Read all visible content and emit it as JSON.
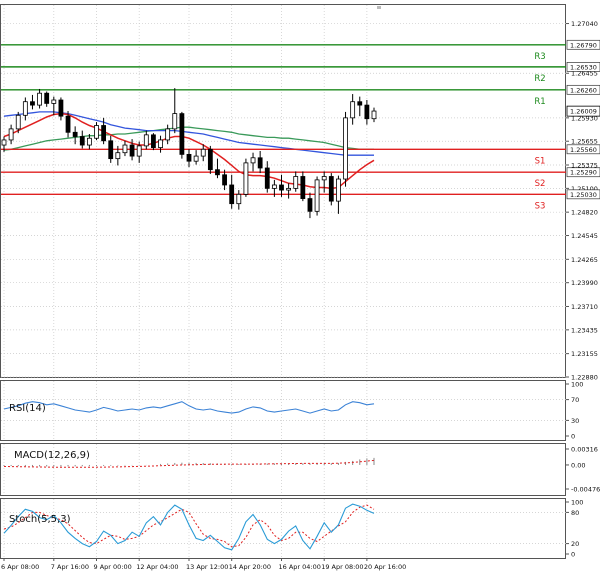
{
  "chart_data": {
    "type": "candlestick",
    "main": {
      "y_ticks": [
        "1.27040",
        "1.26455",
        "1.25930",
        "1.25655",
        "1.25375",
        "1.25100",
        "1.24820",
        "1.24545",
        "1.24265",
        "1.23990",
        "1.23710",
        "1.23435",
        "1.23155",
        "1.22880"
      ],
      "y_range": [
        1.2288,
        1.2727
      ],
      "levels": [
        {
          "name": "R3",
          "value": 1.2679,
          "label": "1.26790",
          "color": "#1e8a1e"
        },
        {
          "name": "R2",
          "value": 1.2653,
          "label": "1.26530",
          "color": "#1e8a1e"
        },
        {
          "name": "R1",
          "value": 1.2626,
          "label": "1.26260",
          "color": "#1e8a1e"
        },
        {
          "name": "S1",
          "value": 1.2556,
          "label": "1.25560",
          "color": "#e02020"
        },
        {
          "name": "S2",
          "value": 1.2529,
          "label": "1.25290",
          "color": "#e02020"
        },
        {
          "name": "S3",
          "value": 1.2503,
          "label": "1.25030",
          "color": "#e02020"
        }
      ],
      "current_price": {
        "value": 1.26009,
        "label": "1.26009"
      },
      "candles": [
        [
          1.2561,
          1.2571,
          1.2553,
          1.2567
        ],
        [
          1.2567,
          1.2585,
          1.2562,
          1.258
        ],
        [
          1.258,
          1.26,
          1.2575,
          1.2596
        ],
        [
          1.2596,
          1.2617,
          1.259,
          1.2612
        ],
        [
          1.2612,
          1.262,
          1.2603,
          1.2608
        ],
        [
          1.2608,
          1.2627,
          1.2604,
          1.2622
        ],
        [
          1.2622,
          1.2624,
          1.2606,
          1.261
        ],
        [
          1.261,
          1.2618,
          1.2596,
          1.2614
        ],
        [
          1.2614,
          1.2617,
          1.259,
          1.2595
        ],
        [
          1.2595,
          1.2601,
          1.257,
          1.2576
        ],
        [
          1.2576,
          1.2583,
          1.2562,
          1.2571
        ],
        [
          1.2571,
          1.2578,
          1.2557,
          1.2561
        ],
        [
          1.2561,
          1.2574,
          1.2556,
          1.2569
        ],
        [
          1.2569,
          1.2588,
          1.2567,
          1.2584
        ],
        [
          1.2584,
          1.2593,
          1.2562,
          1.2566
        ],
        [
          1.2566,
          1.2572,
          1.254,
          1.2545
        ],
        [
          1.2545,
          1.256,
          1.2537,
          1.2552
        ],
        [
          1.2552,
          1.2566,
          1.2548,
          1.2561
        ],
        [
          1.2561,
          1.2568,
          1.2543,
          1.2548
        ],
        [
          1.2548,
          1.2565,
          1.254,
          1.256
        ],
        [
          1.256,
          1.2578,
          1.2556,
          1.2573
        ],
        [
          1.2573,
          1.2575,
          1.2555,
          1.2558
        ],
        [
          1.2558,
          1.2572,
          1.2552,
          1.2567
        ],
        [
          1.2567,
          1.2585,
          1.2562,
          1.258
        ],
        [
          1.258,
          1.2628,
          1.2575,
          1.2598
        ],
        [
          1.2598,
          1.26,
          1.2545,
          1.255
        ],
        [
          1.255,
          1.2556,
          1.2535,
          1.2542
        ],
        [
          1.2542,
          1.2555,
          1.2538,
          1.2548
        ],
        [
          1.2548,
          1.2562,
          1.2542,
          1.2556
        ],
        [
          1.2556,
          1.256,
          1.2527,
          1.2532
        ],
        [
          1.2532,
          1.2545,
          1.2522,
          1.2526
        ],
        [
          1.2526,
          1.2532,
          1.2508,
          1.2514
        ],
        [
          1.2514,
          1.2526,
          1.2486,
          1.2492
        ],
        [
          1.2492,
          1.2508,
          1.2485,
          1.2503
        ],
        [
          1.2503,
          1.2545,
          1.25,
          1.254
        ],
        [
          1.254,
          1.2552,
          1.253,
          1.2546
        ],
        [
          1.2546,
          1.2554,
          1.2528,
          1.2534
        ],
        [
          1.2534,
          1.2542,
          1.2505,
          1.251
        ],
        [
          1.251,
          1.252,
          1.25,
          1.2514
        ],
        [
          1.2514,
          1.2526,
          1.25,
          1.2508
        ],
        [
          1.2508,
          1.2516,
          1.2498,
          1.251
        ],
        [
          1.251,
          1.253,
          1.2506,
          1.2524
        ],
        [
          1.2524,
          1.253,
          1.2495,
          1.2498
        ],
        [
          1.2498,
          1.2505,
          1.2475,
          1.2483
        ],
        [
          1.2483,
          1.2524,
          1.2478,
          1.252
        ],
        [
          1.252,
          1.253,
          1.2505,
          1.2524
        ],
        [
          1.2524,
          1.2528,
          1.249,
          1.2495
        ],
        [
          1.2495,
          1.2525,
          1.248,
          1.2521
        ],
        [
          1.2521,
          1.26,
          1.2512,
          1.2593
        ],
        [
          1.2593,
          1.2621,
          1.2585,
          1.2612
        ],
        [
          1.2612,
          1.2618,
          1.2595,
          1.2608
        ],
        [
          1.2608,
          1.2614,
          1.2585,
          1.2592
        ],
        [
          1.2592,
          1.2605,
          1.2588,
          1.2601
        ]
      ],
      "ma_red": [
        1.2571,
        1.2574,
        1.2578,
        1.2582,
        1.2586,
        1.259,
        1.2594,
        1.2597,
        1.2598,
        1.2597,
        1.2593,
        1.2588,
        1.2584,
        1.2581,
        1.2577,
        1.2573,
        1.2569,
        1.2566,
        1.2563,
        1.2561,
        1.2561,
        1.2563,
        1.2566,
        1.2569,
        1.2571,
        1.2571,
        1.2569,
        1.2565,
        1.2561,
        1.2556,
        1.255,
        1.2544,
        1.2537,
        1.253,
        1.2526,
        1.2525,
        1.2525,
        1.2524,
        1.2522,
        1.2519,
        1.2516,
        1.2515,
        1.2514,
        1.2512,
        1.2511,
        1.2511,
        1.251,
        1.2511,
        1.2518,
        1.2525,
        1.2532,
        1.2538,
        1.2543
      ],
      "ma_blue": [
        1.2595,
        1.2596,
        1.2597,
        1.2598,
        1.2599,
        1.26,
        1.26,
        1.26,
        1.2599,
        1.2598,
        1.2596,
        1.2594,
        1.2592,
        1.259,
        1.2588,
        1.2585,
        1.2583,
        1.2581,
        1.258,
        1.2579,
        1.2578,
        1.2578,
        1.2578,
        1.2578,
        1.2578,
        1.2577,
        1.2576,
        1.2575,
        1.2574,
        1.2572,
        1.257,
        1.2568,
        1.2566,
        1.2564,
        1.2563,
        1.2562,
        1.2561,
        1.256,
        1.2559,
        1.2558,
        1.2557,
        1.2556,
        1.2555,
        1.2554,
        1.2553,
        1.2552,
        1.2551,
        1.255,
        1.2549,
        1.2549,
        1.2549,
        1.2549,
        1.2549
      ],
      "ma_green": [
        1.2555,
        1.2556,
        1.2558,
        1.256,
        1.2562,
        1.2564,
        1.2566,
        1.2567,
        1.2568,
        1.2569,
        1.257,
        1.2571,
        1.2572,
        1.2572,
        1.2573,
        1.2573,
        1.2574,
        1.2574,
        1.2575,
        1.2576,
        1.2577,
        1.2578,
        1.2579,
        1.258,
        1.2581,
        1.2582,
        1.2582,
        1.2581,
        1.258,
        1.2579,
        1.2578,
        1.2577,
        1.2576,
        1.2574,
        1.2573,
        1.2572,
        1.2571,
        1.257,
        1.257,
        1.2569,
        1.2569,
        1.2568,
        1.2567,
        1.2566,
        1.2565,
        1.2564,
        1.2562,
        1.256,
        1.2558,
        1.2557,
        1.2556,
        1.2556,
        1.2556
      ]
    },
    "x_labels": [
      {
        "i": 0,
        "text": "6 Apr 08:00"
      },
      {
        "i": 7,
        "text": "7 Apr 16:00"
      },
      {
        "i": 13,
        "text": "9 Apr 00:00"
      },
      {
        "i": 19,
        "text": "12 Apr 04:00"
      },
      {
        "i": 26,
        "text": "13 Apr 12:00"
      },
      {
        "i": 32,
        "text": "14 Apr 20:00"
      },
      {
        "i": 39,
        "text": "16 Apr 04:00"
      },
      {
        "i": 45,
        "text": "19 Apr 08:00"
      },
      {
        "i": 51,
        "text": "20 Apr 16:00"
      }
    ],
    "rsi": {
      "label": "RSI(14)",
      "ticks": [
        "100",
        "70",
        "30",
        "0"
      ],
      "range": [
        0,
        100
      ],
      "levels": [
        70,
        30
      ],
      "values": [
        52,
        55,
        58,
        63,
        66,
        64,
        60,
        62,
        58,
        54,
        50,
        48,
        46,
        50,
        55,
        52,
        48,
        50,
        52,
        50,
        54,
        56,
        54,
        58,
        62,
        66,
        58,
        52,
        50,
        52,
        48,
        46,
        44,
        46,
        52,
        56,
        54,
        48,
        46,
        48,
        50,
        52,
        48,
        44,
        48,
        52,
        48,
        50,
        60,
        66,
        64,
        60,
        62
      ]
    },
    "macd": {
      "label": "MACD(12,26,9)",
      "ticks": [
        "0.00316",
        "0.00",
        "-0.004763"
      ],
      "range": [
        -0.004763,
        0.00316
      ],
      "histogram": [
        -0.0002,
        -0.00022,
        -0.00024,
        -0.00026,
        -0.00028,
        -0.0003,
        -0.0003,
        -0.00032,
        -0.0003,
        -0.00028,
        -0.00028,
        -0.00026,
        -0.00024,
        -0.0002,
        -0.00018,
        -0.00016,
        -0.00012,
        -0.0001,
        -8e-05,
        -6e-05,
        -4e-05,
        0.0,
        0.0002,
        0.0003,
        0.0004,
        0.00045,
        0.00042,
        0.0004,
        0.00038,
        0.00034,
        0.0003,
        0.00026,
        0.0002,
        0.00018,
        0.0002,
        0.00024,
        0.00026,
        0.00028,
        0.0003,
        0.00032,
        0.00034,
        0.00036,
        0.00034,
        0.00032,
        0.0003,
        0.00032,
        0.00034,
        0.0004,
        0.0006,
        0.0008,
        0.0011,
        0.0013,
        0.0014
      ],
      "signal": [
        -0.0003,
        -0.00032,
        -0.00034,
        -0.00036,
        -0.00038,
        -0.0004,
        -0.00042,
        -0.00044,
        -0.00045,
        -0.00046,
        -0.00046,
        -0.00046,
        -0.00045,
        -0.00044,
        -0.00042,
        -0.0004,
        -0.00038,
        -0.00035,
        -0.00032,
        -0.00028,
        -0.00024,
        -0.0002,
        -0.00015,
        -0.0001,
        -5e-05,
        0.0,
        3e-05,
        6e-05,
        0.0001,
        0.00012,
        0.00014,
        0.00015,
        0.00016,
        0.00016,
        0.00016,
        0.00017,
        0.00018,
        0.0002,
        0.00022,
        0.00024,
        0.00026,
        0.00028,
        0.0003,
        0.0003,
        0.0003,
        0.0003,
        0.00031,
        0.00034,
        0.0004,
        0.0005,
        0.00062,
        0.00076,
        0.0009
      ]
    },
    "stoch": {
      "label": "Stoch(5,5,3)",
      "ticks": [
        "100",
        "80",
        "20",
        "0"
      ],
      "range": [
        0,
        100
      ],
      "levels": [
        80,
        20
      ],
      "k": [
        40,
        55,
        72,
        86,
        82,
        70,
        66,
        74,
        60,
        42,
        30,
        20,
        14,
        24,
        44,
        36,
        20,
        26,
        42,
        34,
        60,
        72,
        56,
        80,
        94,
        86,
        56,
        30,
        26,
        36,
        24,
        12,
        8,
        30,
        62,
        76,
        56,
        28,
        20,
        28,
        44,
        54,
        26,
        10,
        34,
        60,
        42,
        56,
        88,
        96,
        92,
        84,
        78
      ],
      "d": [
        48,
        52,
        60,
        70,
        80,
        80,
        74,
        70,
        66,
        58,
        45,
        32,
        22,
        20,
        28,
        36,
        34,
        28,
        30,
        34,
        45,
        56,
        62,
        70,
        78,
        86,
        80,
        58,
        38,
        30,
        28,
        24,
        14,
        16,
        32,
        56,
        66,
        56,
        36,
        26,
        30,
        42,
        42,
        30,
        24,
        34,
        44,
        54,
        62,
        80,
        90,
        94,
        86
      ]
    }
  }
}
